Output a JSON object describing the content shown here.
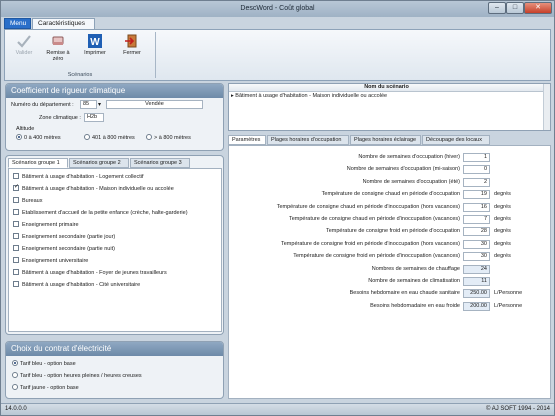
{
  "window": {
    "title": "DescWord - Coût global"
  },
  "ribbon": {
    "tabs": [
      "Menu",
      "Caractéristiques"
    ],
    "buttons": {
      "valider": "Valider",
      "remise": "Remise à zéro",
      "imprimer": "Imprimer",
      "fermer": "Fermer"
    },
    "group": "Scénarios"
  },
  "coef": {
    "title": "Coefficient de rigueur climatique",
    "dept_label": "Numéro du département :",
    "dept_value": "85",
    "dept_name": "Vendée",
    "zone_label": "Zone climatique :",
    "zone_value": "H2b",
    "altitude_label": "Altitude",
    "altitudes": [
      "0 à 400 mètres",
      "401 à 800 mètres",
      "> à 800 mètres"
    ],
    "altitude_selected": 0
  },
  "scenarios": {
    "tabs": [
      "Scénarios groupe 1",
      "Scénarios groupe 2",
      "Scénarios groupe 3"
    ],
    "items": [
      "Bâtiment à usage d'habitation - Logement collectif",
      "Bâtiment à usage d'habitation - Maison individuelle ou accolée",
      "Bureaux",
      "Etablissement d'accueil de la petite enfance (crèche, halte-garderie)",
      "Enseignement primaire",
      "Enseignement secondaire (partie jour)",
      "Enseignement secondaire (partie nuit)",
      "Enseignement universitaire",
      "Bâtiment à usage d'habitation - Foyer de jeunes travailleurs",
      "Bâtiment à usage d'habitation - Cité universitaire"
    ],
    "checked_index": 1
  },
  "contrat": {
    "title": "Choix du contrat d'électricité",
    "options": [
      "Tarif bleu - option base",
      "Tarif bleu - option heures pleines / heures creuses",
      "Tarif jaune - option base"
    ],
    "selected": 0
  },
  "scenario_table": {
    "header": "Nom du scénario",
    "row": "Bâtiment à usage d'habitation - Maison individuelle ou accolée"
  },
  "param_tabs": [
    "Paramètres",
    "Plages horaires d'occupation",
    "Plages horaires éclairage",
    "Découpage des locaux"
  ],
  "params": [
    {
      "label": "Nombre de semaines d'occupation (hiver)",
      "value": "1",
      "unit": ""
    },
    {
      "label": "Nombre de semaines d'occupation (mi-saison)",
      "value": "0",
      "unit": ""
    },
    {
      "label": "Nombre de semaines d'occupation (été)",
      "value": "2",
      "unit": ""
    },
    {
      "label": "Température de consigne chaud en période d'occupation",
      "value": "19",
      "unit": "degrés"
    },
    {
      "label": "Température de consigne chaud en période d'inoccupation (hors vacances)",
      "value": "16",
      "unit": "degrés"
    },
    {
      "label": "Température de consigne chaud en période d'inoccupation (vacances)",
      "value": "7",
      "unit": "degrés"
    },
    {
      "label": "Température de consigne froid en période d'occupation",
      "value": "28",
      "unit": "degrés"
    },
    {
      "label": "Température de consigne froid en période d'inoccupation (hors vacances)",
      "value": "30",
      "unit": "degrés"
    },
    {
      "label": "Température de consigne froid en période d'inoccupation (vacances)",
      "value": "30",
      "unit": "degrés"
    },
    {
      "label": "Nombres de semaines de chauffage",
      "value": "24",
      "unit": ""
    },
    {
      "label": "Nombre de semaines de climatisation",
      "value": "11",
      "unit": ""
    },
    {
      "label": "Besoins hebdomaire en eau chaude sanitaire",
      "value": "250.00",
      "unit": "L/Personne"
    },
    {
      "label": "Besoins hebdomadaire en eau froide",
      "value": "200.00",
      "unit": "L/Personne"
    }
  ],
  "status": {
    "version": "14.0.0.0",
    "copyright": "© AJ SOFT 1994 - 2014"
  }
}
